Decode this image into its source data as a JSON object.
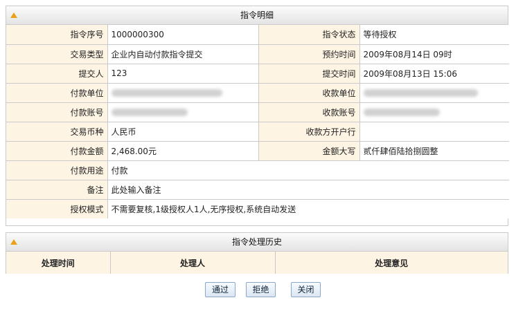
{
  "detail_panel": {
    "title": "指令明细",
    "rows": [
      {
        "l1": "指令序号",
        "v1": "1000000300",
        "l2": "指令状态",
        "v2": "等待授权"
      },
      {
        "l1": "交易类型",
        "v1": "企业内自动付款指令提交",
        "l2": "预约时间",
        "v2": "2009年08月14日 09时"
      },
      {
        "l1": "提交人",
        "v1": "123",
        "l2": "提交时间",
        "v2": "2009年08月13日 15:06"
      },
      {
        "l1": "付款单位",
        "v1": "",
        "l2": "收款单位",
        "v2": ""
      },
      {
        "l1": "付款账号",
        "v1": "",
        "l2": "收款账号",
        "v2": ""
      },
      {
        "l1": "交易币种",
        "v1": "人民币",
        "l2": "收款方开户行",
        "v2": ""
      },
      {
        "l1": "付款金额",
        "v1": "2,468.00元",
        "l2": "金额大写",
        "v2": "贰仟肆佰陆拾捌圆整"
      }
    ],
    "wide_rows": [
      {
        "label": "付款用途",
        "value": "付款"
      },
      {
        "label": "备注",
        "value": "此处输入备注"
      },
      {
        "label": "授权模式",
        "value": "不需要复核,1级授权人1人,无序授权,系统自动发送"
      }
    ]
  },
  "history_panel": {
    "title": "指令处理历史",
    "columns": [
      "处理时间",
      "处理人",
      "处理意见"
    ]
  },
  "buttons": {
    "approve": "通过",
    "reject": "拒绝",
    "close": "关闭"
  }
}
